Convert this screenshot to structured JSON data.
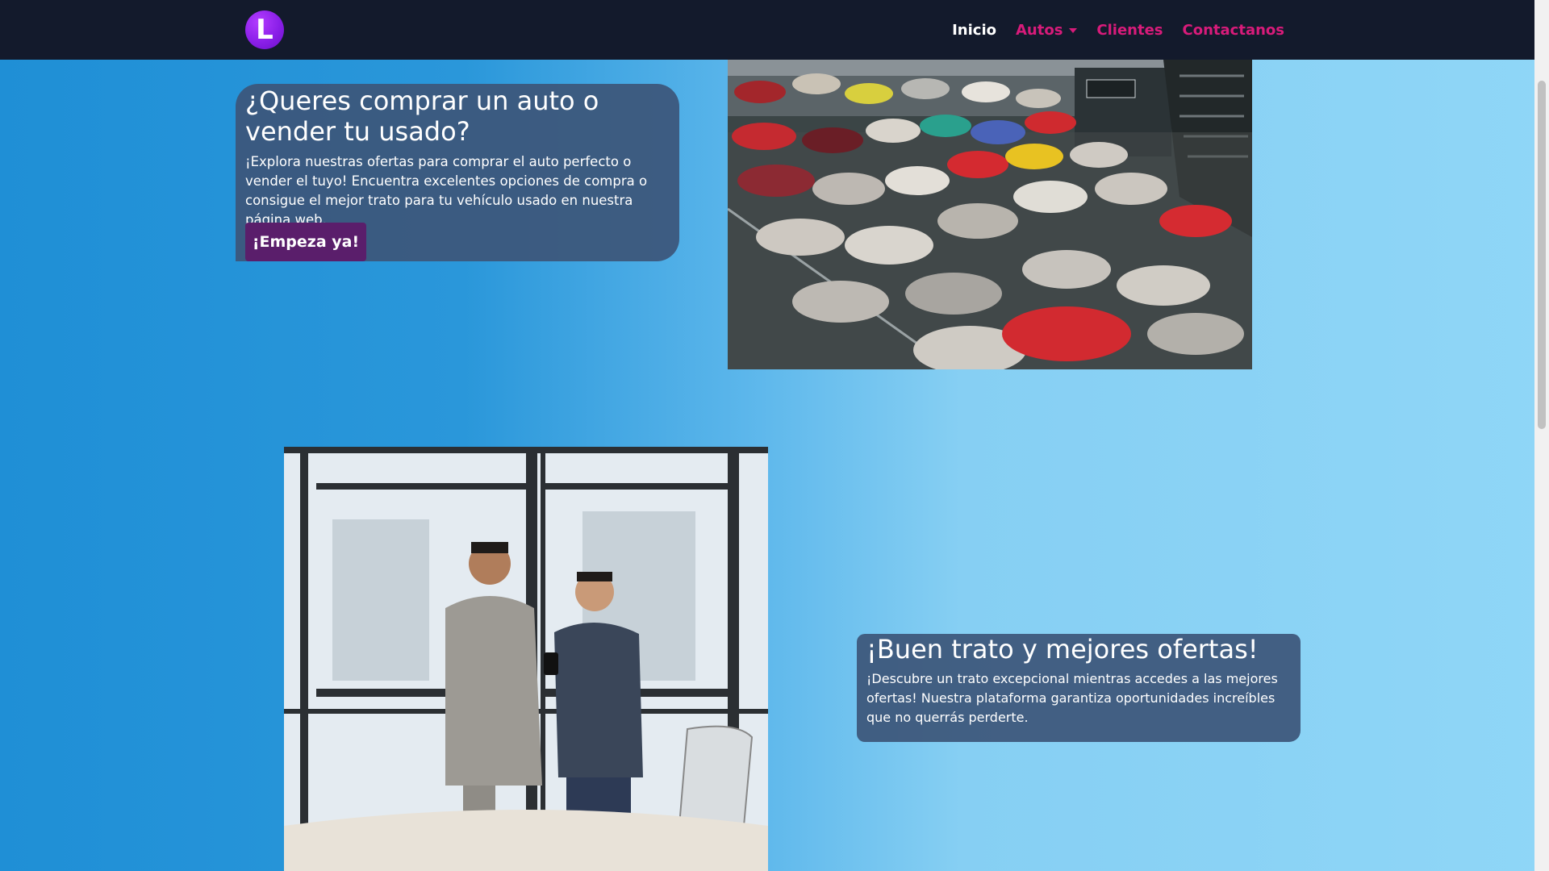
{
  "navbar": {
    "logo_letter": "L",
    "links": {
      "inicio": "Inicio",
      "autos": "Autos",
      "clientes": "Clientes",
      "contactanos": "Contactanos"
    }
  },
  "hero": {
    "title": "¿Queres comprar un auto o vender tu usado?",
    "text": "¡Explora nuestras ofertas para comprar el auto perfecto o vender el tuyo! Encuentra excelentes opciones de compra o consigue el mejor trato para tu vehículo usado en nuestra página web.",
    "button_label": "¡Empeza ya!"
  },
  "offers": {
    "title": "¡Buen trato y mejores ofertas!",
    "text": "¡Descubre un trato excepcional mientras accedes a las mejores ofertas! Nuestra plataforma garantiza oportunidades increíbles que no querrás perderte."
  },
  "colors": {
    "navbar_bg": "#131a2c",
    "link_accent": "#d81b7a",
    "button_bg": "#5a1e6b",
    "card_bg": "#3c567a",
    "logo_purple": "#8a1fe8"
  }
}
